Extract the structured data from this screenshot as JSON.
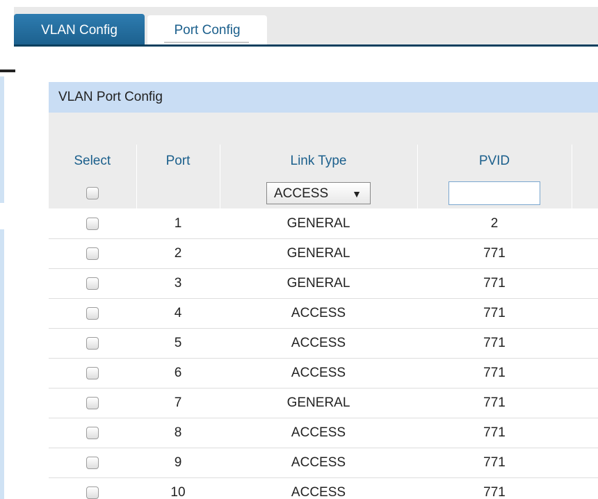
{
  "tabs": [
    {
      "label": "VLAN Config",
      "active": false
    },
    {
      "label": "Port Config",
      "active": true
    }
  ],
  "panel": {
    "title": "VLAN Port Config"
  },
  "table": {
    "columns": [
      "Select",
      "Port",
      "Link Type",
      "PVID"
    ],
    "filter": {
      "link_type_selected": "ACCESS",
      "pvid_value": ""
    },
    "rows": [
      {
        "port": "1",
        "link_type": "GENERAL",
        "pvid": "2"
      },
      {
        "port": "2",
        "link_type": "GENERAL",
        "pvid": "771"
      },
      {
        "port": "3",
        "link_type": "GENERAL",
        "pvid": "771"
      },
      {
        "port": "4",
        "link_type": "ACCESS",
        "pvid": "771"
      },
      {
        "port": "5",
        "link_type": "ACCESS",
        "pvid": "771"
      },
      {
        "port": "6",
        "link_type": "ACCESS",
        "pvid": "771"
      },
      {
        "port": "7",
        "link_type": "GENERAL",
        "pvid": "771"
      },
      {
        "port": "8",
        "link_type": "ACCESS",
        "pvid": "771"
      },
      {
        "port": "9",
        "link_type": "ACCESS",
        "pvid": "771"
      },
      {
        "port": "10",
        "link_type": "ACCESS",
        "pvid": "771"
      }
    ]
  },
  "colors": {
    "tab_active_bg": "#1b5f8c",
    "panel_header_bg": "#c9ddf4",
    "header_text": "#1b5f8c"
  }
}
